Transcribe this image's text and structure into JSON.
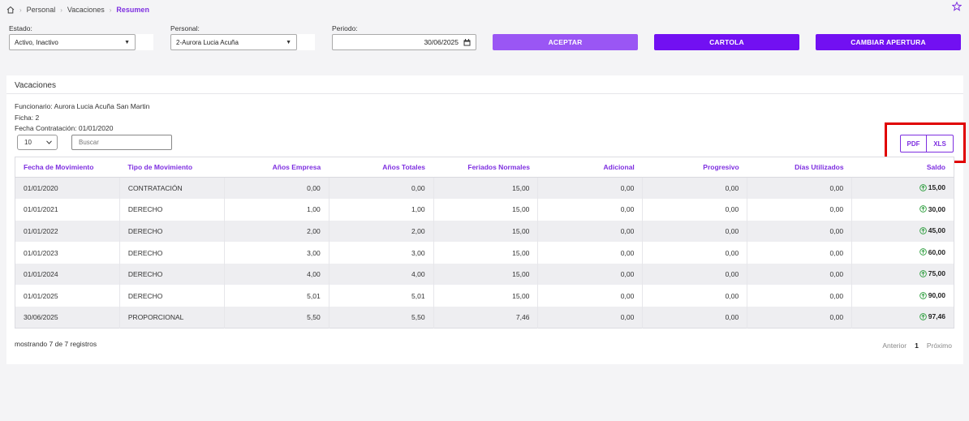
{
  "breadcrumb": {
    "items": [
      "Personal",
      "Vacaciones",
      "Resumen"
    ]
  },
  "filters": {
    "estado_label": "Estado:",
    "estado_value": "Activo, Inactivo",
    "personal_label": "Personal:",
    "personal_value": "2-Aurora Lucia Acuña",
    "periodo_label": "Periodo:",
    "periodo_value": "30/06/2025"
  },
  "buttons": {
    "aceptar": "ACEPTAR",
    "cartola": "CARTOLA",
    "cambiar_apertura": "CAMBIAR APERTURA"
  },
  "panel": {
    "title": "Vacaciones",
    "funcionario": "Funcionario: Aurora Lucia Acuña San Martin",
    "ficha": "Ficha: 2",
    "fecha_contratacion": "Fecha Contratación: 01/01/2020",
    "page_length": "10",
    "search_placeholder": "Buscar",
    "export_pdf": "PDF",
    "export_xls": "XLS"
  },
  "table": {
    "headers": [
      "Fecha de Movimiento",
      "Tipo de Movimiento",
      "Años Empresa",
      "Años Totales",
      "Feriados Normales",
      "Adicional",
      "Progresivo",
      "Días Utilizados",
      "Saldo"
    ],
    "rows": [
      [
        "01/01/2020",
        "CONTRATACIÓN",
        "0,00",
        "0,00",
        "15,00",
        "0,00",
        "0,00",
        "0,00",
        "15,00"
      ],
      [
        "01/01/2021",
        "DERECHO",
        "1,00",
        "1,00",
        "15,00",
        "0,00",
        "0,00",
        "0,00",
        "30,00"
      ],
      [
        "01/01/2022",
        "DERECHO",
        "2,00",
        "2,00",
        "15,00",
        "0,00",
        "0,00",
        "0,00",
        "45,00"
      ],
      [
        "01/01/2023",
        "DERECHO",
        "3,00",
        "3,00",
        "15,00",
        "0,00",
        "0,00",
        "0,00",
        "60,00"
      ],
      [
        "01/01/2024",
        "DERECHO",
        "4,00",
        "4,00",
        "15,00",
        "0,00",
        "0,00",
        "0,00",
        "75,00"
      ],
      [
        "01/01/2025",
        "DERECHO",
        "5,01",
        "5,01",
        "15,00",
        "0,00",
        "0,00",
        "0,00",
        "90,00"
      ],
      [
        "30/06/2025",
        "PROPORCIONAL",
        "5,50",
        "5,50",
        "7,46",
        "0,00",
        "0,00",
        "0,00",
        "97,46"
      ]
    ]
  },
  "footer": {
    "records": "mostrando 7 de 7 registros",
    "prev": "Anterior",
    "page": "1",
    "next": "Próximo"
  },
  "colors": {
    "accent": "#7e2fe0",
    "button_light": "#9a56f4",
    "button_dark": "#7210f2",
    "highlight": "#e00000",
    "saldo_icon": "#2e9e3e"
  }
}
